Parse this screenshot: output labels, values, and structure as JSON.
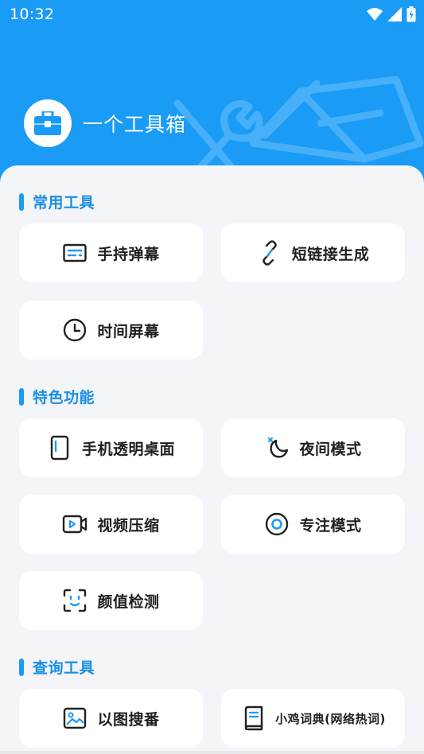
{
  "status_bar": {
    "time": "10:32"
  },
  "app": {
    "title": "一个工具箱"
  },
  "sections": [
    {
      "title": "常用工具",
      "items": [
        {
          "label": "手持弹幕",
          "icon": "subtitles-icon"
        },
        {
          "label": "短链接生成",
          "icon": "link-icon"
        },
        {
          "label": "时间屏幕",
          "icon": "clock-icon"
        }
      ]
    },
    {
      "title": "特色功能",
      "items": [
        {
          "label": "手机透明桌面",
          "icon": "phone-icon"
        },
        {
          "label": "夜间模式",
          "icon": "moon-icon"
        },
        {
          "label": "视频压缩",
          "icon": "video-icon"
        },
        {
          "label": "专注模式",
          "icon": "target-icon"
        },
        {
          "label": "颜值检测",
          "icon": "face-scan-icon"
        }
      ]
    },
    {
      "title": "查询工具",
      "items": [
        {
          "label": "以图搜番",
          "icon": "image-icon"
        },
        {
          "label": "小鸡词典(网络热词)",
          "icon": "book-icon"
        }
      ]
    }
  ],
  "colors": {
    "accent": "#1a9bf6",
    "section_title": "#1a8ee6",
    "background": "#f3f5f9",
    "card": "#ffffff",
    "text": "#1f1f1f"
  }
}
